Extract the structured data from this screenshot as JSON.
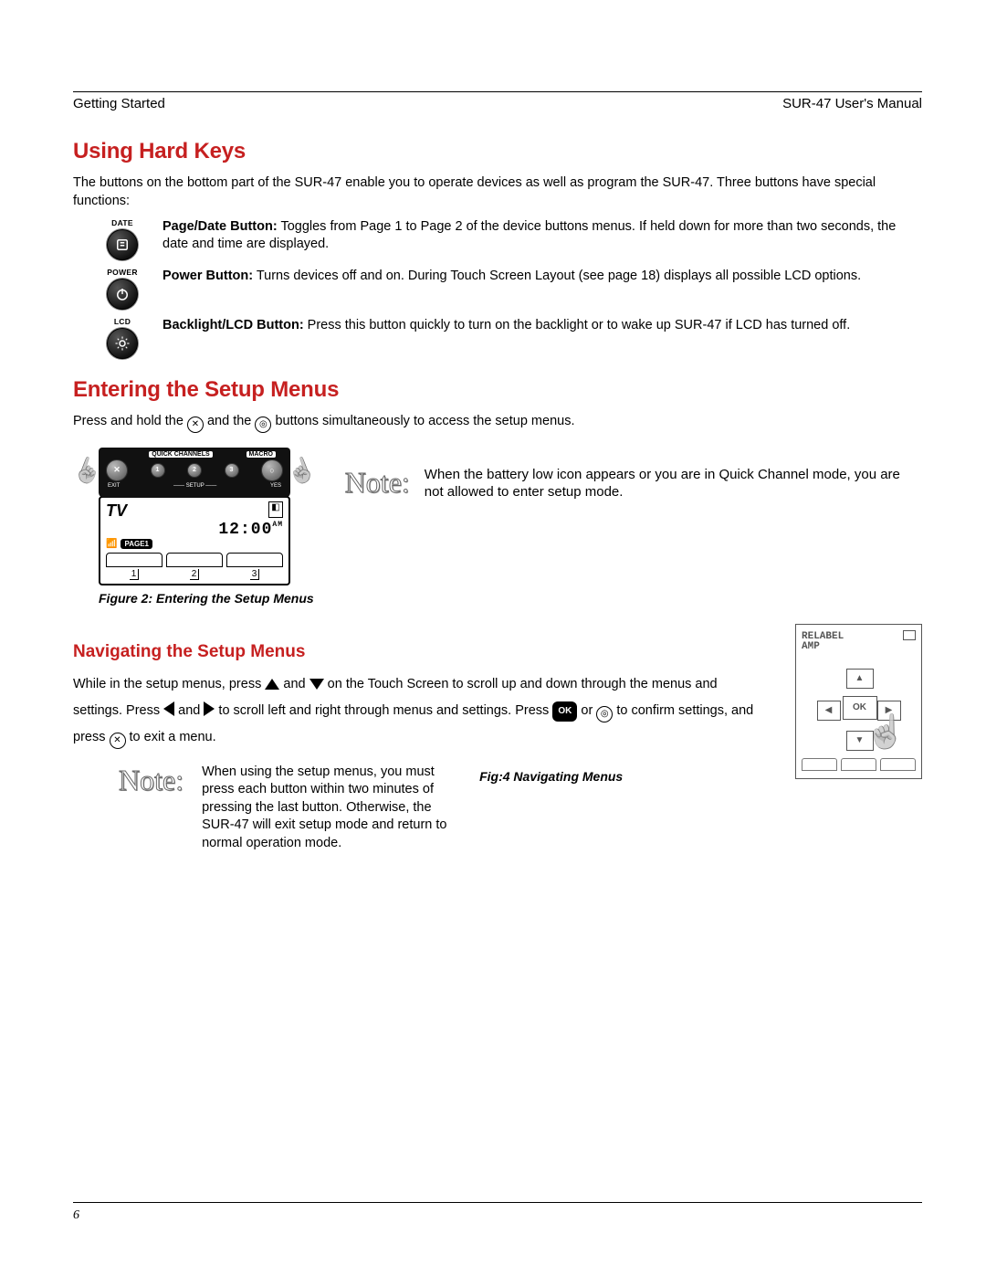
{
  "header": {
    "left": "Getting Started",
    "right": "SUR-47 User's Manual"
  },
  "sections": {
    "hardkeys": {
      "title": "Using Hard Keys",
      "intro": "The buttons on the bottom part of the SUR-47 enable you to operate devices as well as program the SUR-47. Three buttons have special functions:",
      "items": [
        {
          "icon_label": "DATE",
          "bold": "Page/Date Button:",
          "text": " Toggles from Page 1 to Page 2 of the device buttons menus. If held down for more than two seconds, the date and time are displayed."
        },
        {
          "icon_label": "POWER",
          "bold": "Power Button:",
          "text": " Turns devices off and on. During Touch Screen Layout (see page 18) displays all possible LCD options."
        },
        {
          "icon_label": "LCD",
          "bold": "Backlight/LCD Button:",
          "text": " Press this button quickly to turn on the backlight or to wake up SUR-47 if LCD has turned off."
        }
      ]
    },
    "setup": {
      "title": "Entering the Setup Menus",
      "intro_pre": "Press and hold the ",
      "intro_mid": " and the ",
      "intro_post": " buttons simultaneously to access the setup menus.",
      "fig_caption": "Figure 2: Entering the Setup Menus",
      "fig2": {
        "top_left_label": "QUICK CHANNELS",
        "top_right_label": "MACRO",
        "nums": [
          "1",
          "2",
          "3"
        ],
        "sub_left": "EXIT",
        "sub_mid": "SETUP",
        "sub_right": "YES",
        "lcd_device": "TV",
        "lcd_time": "12:00",
        "lcd_ampm": "AM",
        "lcd_page": "PAGE1",
        "lcd_nums": [
          "1",
          "2",
          "3"
        ]
      },
      "note_label": "Note:",
      "note_text": "When the battery low icon appears or you are in Quick Channel mode, you are not allowed to enter setup mode."
    },
    "nav": {
      "title": "Navigating the Setup Menus",
      "p1_a": "While in the setup menus, press ",
      "p1_b": " and ",
      "p1_c": " on the Touch Screen to scroll up and down through the menus and settings. Press ",
      "p1_d": " and ",
      "p1_e": " to scroll left and right through menus and settings. Press ",
      "ok_label": "OK",
      "p1_f": " or ",
      "p1_g": " to confirm settings, and press ",
      "p1_h": " to exit a menu.",
      "note_label": "Note:",
      "note_text": "When using the setup menus, you must press each button within two minutes of pressing the last button. Otherwise, the SUR-47 will exit setup mode and return to normal operation mode.",
      "fig4_caption": "Fig:4  Navigating Menus",
      "fig4": {
        "line1": "RELABEL",
        "line2": "AMP",
        "ok": "OK"
      }
    }
  },
  "glyphs": {
    "x": "✕",
    "o": "◎"
  },
  "page_number": "6"
}
